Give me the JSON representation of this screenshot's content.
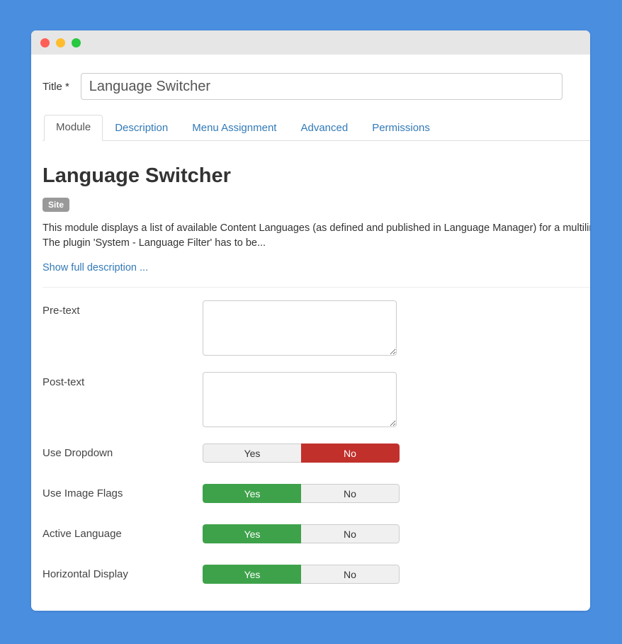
{
  "window": {
    "traffic_lights": [
      {
        "name": "close",
        "color": "#ff5f57"
      },
      {
        "name": "minimize",
        "color": "#ffbd2e"
      },
      {
        "name": "zoom",
        "color": "#28c840"
      }
    ]
  },
  "background_color": "#4a8ee0",
  "title_field": {
    "label": "Title *",
    "value": "Language Switcher",
    "placeholder": ""
  },
  "tabs": [
    {
      "label": "Module",
      "active": true
    },
    {
      "label": "Description",
      "active": false
    },
    {
      "label": "Menu Assignment",
      "active": false
    },
    {
      "label": "Advanced",
      "active": false
    },
    {
      "label": "Permissions",
      "active": false
    }
  ],
  "module": {
    "heading": "Language Switcher",
    "badge": "Site",
    "description": "This module displays a list of available Content Languages (as defined and published in Language Manager) for a multilingual site. --The plugin 'System - Language Filter' has to be...",
    "show_full_link": "Show full description ..."
  },
  "form": {
    "fields": [
      {
        "type": "textarea",
        "label": "Pre-text",
        "value": "",
        "placeholder": ""
      },
      {
        "type": "textarea",
        "label": "Post-text",
        "value": "",
        "placeholder": ""
      },
      {
        "type": "toggle",
        "label": "Use Dropdown",
        "yes": "Yes",
        "no": "No",
        "selected": "No"
      },
      {
        "type": "toggle",
        "label": "Use Image Flags",
        "yes": "Yes",
        "no": "No",
        "selected": "Yes"
      },
      {
        "type": "toggle",
        "label": "Active Language",
        "yes": "Yes",
        "no": "No",
        "selected": "Yes"
      },
      {
        "type": "toggle",
        "label": "Horizontal Display",
        "yes": "Yes",
        "no": "No",
        "selected": "Yes"
      }
    ]
  },
  "colors": {
    "link": "#337ab7",
    "yes_active": "#3ea24a",
    "no_active": "#c2302c",
    "badge": "#999999"
  }
}
